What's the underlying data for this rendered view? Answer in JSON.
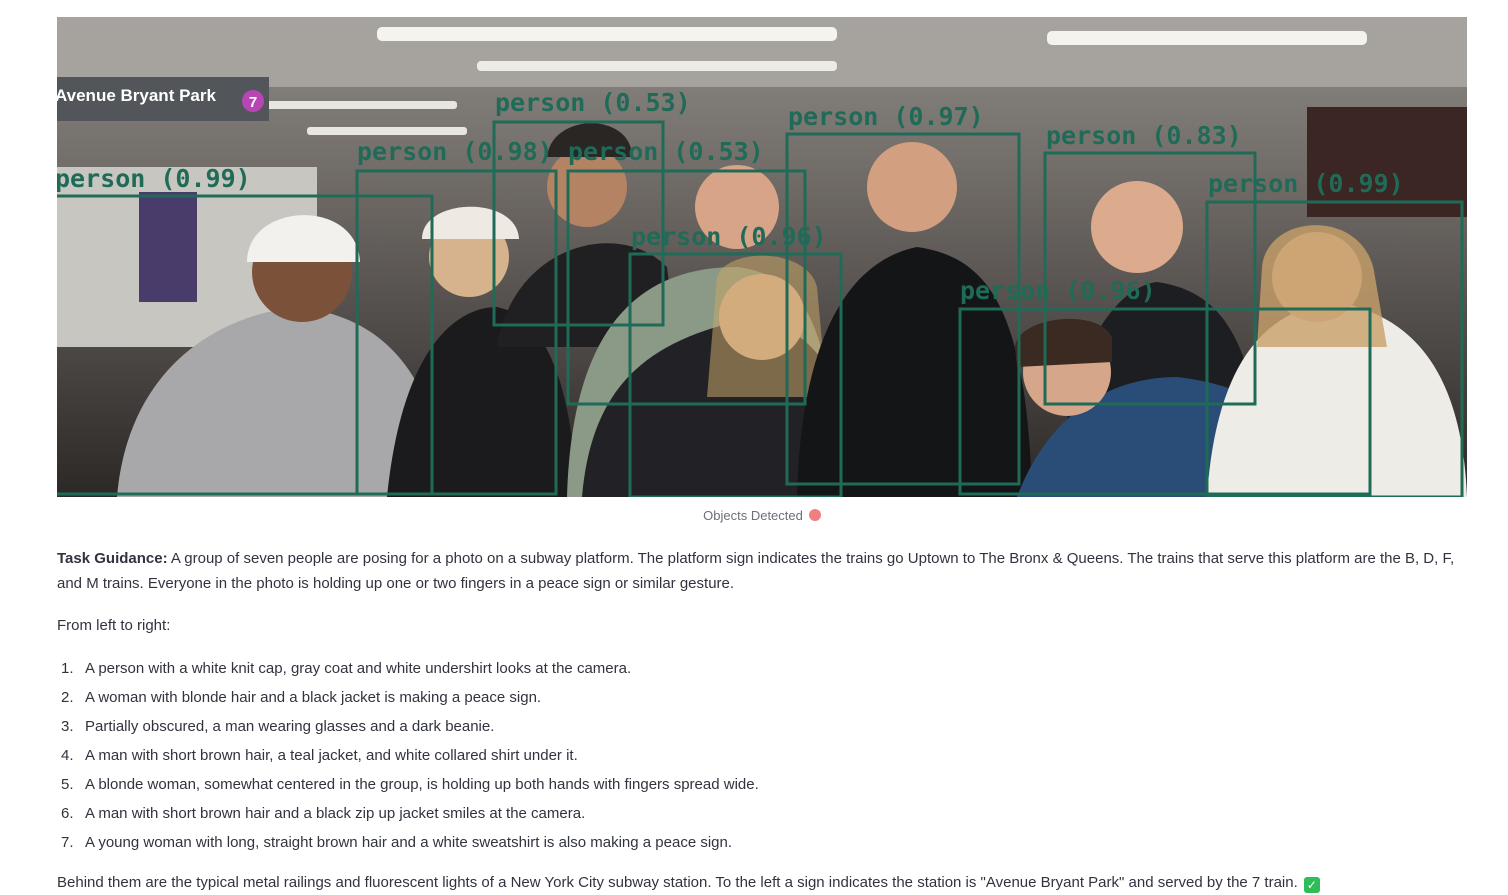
{
  "image": {
    "station_sign": "Avenue Bryant Park",
    "train_number": "7",
    "detections": [
      {
        "label": "person (0.99)",
        "score": 0.99
      },
      {
        "label": "person (0.98)",
        "score": 0.98
      },
      {
        "label": "person (0.53)",
        "score": 0.53
      },
      {
        "label": "person (0.53)",
        "score": 0.53
      },
      {
        "label": "person (0.96)",
        "score": 0.96
      },
      {
        "label": "person (0.97)",
        "score": 0.97
      },
      {
        "label": "person (0.83)",
        "score": 0.83
      },
      {
        "label": "person (0.96)",
        "score": 0.96
      },
      {
        "label": "person (0.99)",
        "score": 0.99
      }
    ],
    "box_color": "#1f6b57"
  },
  "caption": {
    "text": "Objects Detected",
    "status_color": "#f08080"
  },
  "guidance": {
    "heading": "Task Guidance:",
    "text": " A group of seven people are posing for a photo on a subway platform. The platform sign indicates the trains go Uptown to The Bronx & Queens. The trains that serve this platform are the B, D, F, and M trains. Everyone in the photo is holding up one or two fingers in a peace sign or similar gesture."
  },
  "from_left": "From left to right:",
  "people": [
    {
      "num": "1.",
      "text": "A person with a white knit cap, gray coat and white undershirt looks at the camera."
    },
    {
      "num": "2.",
      "text": "A woman with blonde hair and a black jacket is making a peace sign."
    },
    {
      "num": "3.",
      "text": "Partially obscured, a man wearing glasses and a dark beanie."
    },
    {
      "num": "4.",
      "text": "A man with short brown hair, a teal jacket, and white collared shirt under it."
    },
    {
      "num": "5.",
      "text": "A blonde woman, somewhat centered in the group, is holding up both hands with fingers spread wide."
    },
    {
      "num": "6.",
      "text": "A man with short brown hair and a black zip up jacket smiles at the camera."
    },
    {
      "num": "7.",
      "text": "A young woman with long, straight brown hair and a white sweatshirt is also making a peace sign."
    }
  ],
  "closing": "Behind them are the typical metal railings and fluorescent lights of a New York City subway station. To the left a sign indicates the station is \"Avenue Bryant Park\" and served by the 7 train.",
  "closing_icon": "check-mark-icon"
}
